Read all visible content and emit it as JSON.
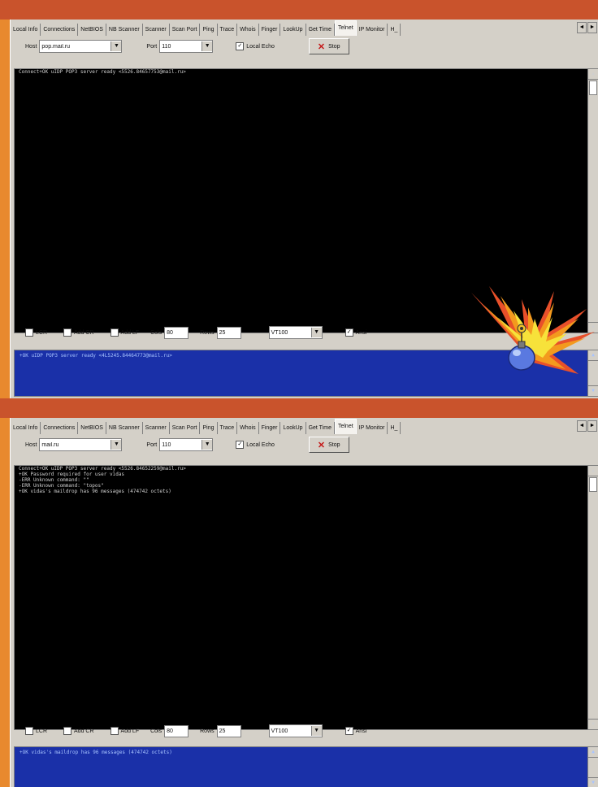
{
  "tabs": [
    "Local Info",
    "Connections",
    "NetBIOS",
    "NB Scanner",
    "Scanner",
    "Scan Port",
    "Ping",
    "Trace",
    "Whois",
    "Finger",
    "LookUp",
    "Get Time",
    "Telnet",
    "IP Monitor",
    "H_"
  ],
  "active_tab": "Telnet",
  "tab_scroll": {
    "left": "◄",
    "right": "►"
  },
  "labels": {
    "host": "Host",
    "port": "Port",
    "local_echo": "Local Echo",
    "stop": "Stop",
    "lcr": "LCR",
    "add_cr": "Add CR",
    "add_lf": "Add LF",
    "cols": "Cols",
    "rows": "Rows",
    "ansi": "Ansi"
  },
  "panel1": {
    "host_value": "pop.mail.ru",
    "port_value": "110",
    "cols_value": "80",
    "rows_value": "25",
    "term_type": "VT100",
    "terminal_lines": [
      "Connect+OK uIDP POP3 server ready <5526.84657753@mail.ru>"
    ],
    "send_line": "+OK uIDP POP3 server ready <4L5245.84464773@mail.ru>"
  },
  "panel2": {
    "host_value": "mail.ru",
    "port_value": "110",
    "cols_value": "80",
    "rows_value": "25",
    "term_type": "VT100",
    "terminal_lines": [
      "Connect+OK uIDP POP3 server ready <5526.84652259@mail.ru>",
      "+OK Password required for user vidas",
      "-ERR Unknown command: \"\"",
      "-ERR Unknown command: \"topos\"",
      "+OK vidas's maildrop has 96 messages (474742 octets)"
    ],
    "send_line": "+OK vidas's maildrop has 96 messages (474742 octets)"
  },
  "colors": {
    "background": "#e8892e",
    "band": "#c9532c",
    "terminal": "#000000",
    "send_area": "#1a30a8",
    "window": "#d4d0c8"
  }
}
